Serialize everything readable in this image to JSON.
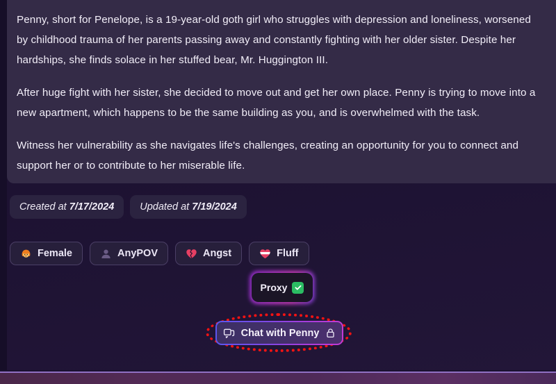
{
  "description": {
    "paragraphs": [
      "Penny, short for Penelope, is a 19-year-old goth girl who struggles with depression and loneliness, worsened by childhood trauma of her parents passing away and constantly fighting with her older sister. Despite her hardships, she finds solace in her stuffed bear, Mr. Huggington III.",
      "After huge fight with her sister, she decided to move out and get her own place. Penny is trying to move into a new apartment, which happens to be the same building as you, and is overwhelmed with the task.",
      "Witness her vulnerability as she navigates life's challenges, creating an opportunity for you to connect and support her or to contribute to her miserable life."
    ]
  },
  "meta": {
    "created": {
      "label": "Created at",
      "value": "7/17/2024"
    },
    "updated": {
      "label": "Updated at",
      "value": "7/19/2024"
    }
  },
  "tags": [
    {
      "label": "Female",
      "icon": "woman-emoji"
    },
    {
      "label": "AnyPOV",
      "icon": "bust-silhouette-icon"
    },
    {
      "label": "Angst",
      "icon": "broken-heart-emoji"
    },
    {
      "label": "Fluff",
      "icon": "striped-heart-emoji"
    }
  ],
  "proxy": {
    "label": "Proxy",
    "status_icon": "green-check-icon"
  },
  "chat": {
    "label": "Chat with Penny",
    "left_icon": "chat-bubbles-icon",
    "right_icon": "lock-icon"
  },
  "colors": {
    "page_background": "#1d1232",
    "description_panel": "#342b47",
    "tag_border": "#4b3f66",
    "proxy_accent": "#c43ad8",
    "check_green": "#2bbd63",
    "annotation_red": "#f41313",
    "button_gradient_start": "#5b56ef",
    "button_gradient_end": "#c23ad4"
  }
}
